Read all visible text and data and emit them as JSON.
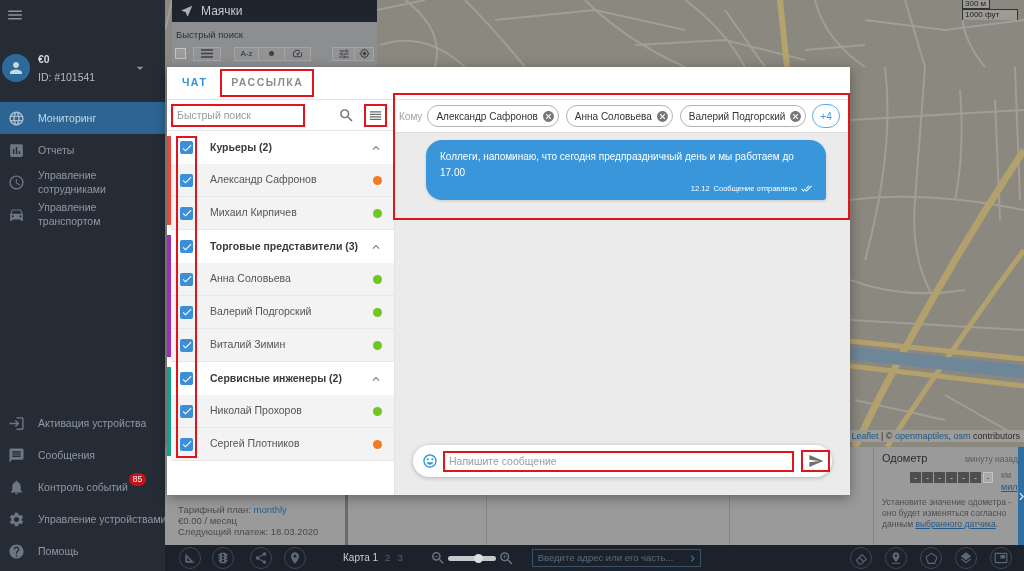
{
  "sidebar": {
    "account": {
      "balance": "€0",
      "id": "ID: #101541"
    },
    "nav_items": [
      {
        "label": "Мониторинг",
        "selected": true
      },
      {
        "label": "Отчеты",
        "selected": false
      },
      {
        "label": "Управление сотрудниками",
        "selected": false
      },
      {
        "label": "Управление транспортом",
        "selected": false
      }
    ],
    "footer_items": [
      {
        "label": "Активация устройства",
        "selected": false
      },
      {
        "label": "Сообщения",
        "selected": false
      },
      {
        "label": "Контроль событий",
        "selected": false,
        "badge": "85"
      },
      {
        "label": "Управление устройствами",
        "selected": false
      },
      {
        "label": "Помощь",
        "selected": false
      }
    ]
  },
  "beacons_panel": {
    "title": "Маячки",
    "search": {
      "placeholder": "Быстрый поиск"
    },
    "select_all": {
      "checked": false
    },
    "sort_label": "A-z"
  },
  "map": {
    "scale": [
      "300 м",
      "1000 фут"
    ],
    "attribution": [
      {
        "kind": "link",
        "text": "Leaflet"
      },
      {
        "kind": "text",
        "text": " | © "
      },
      {
        "kind": "link",
        "text": "openmaptiles"
      },
      {
        "kind": "text",
        "text": ", "
      },
      {
        "kind": "link",
        "text": "osm"
      },
      {
        "kind": "text",
        "text": " contributors"
      }
    ]
  },
  "bottom_panel": {
    "tariff": {
      "label": "Тарифный план:",
      "plan": "monthly"
    },
    "price": "€0.00 / месяц",
    "next_payment": "Следующий платеж: 18.03.2020",
    "odometer": {
      "title": "Одометр",
      "updated": "минуту назад",
      "digits": [
        "-",
        "-",
        "-",
        "-",
        "-",
        "-"
      ],
      "decimal": "-",
      "units": [
        {
          "label": "км",
          "selected": true
        },
        {
          "label": "мил",
          "selected": false
        }
      ],
      "hint": "Установите значение одометра - оно будет изменяться согласно данным ",
      "hint_link": "выбранного датчика",
      "hint_end": "."
    }
  },
  "toolbar": {
    "map_tabs": [
      {
        "label": "Карта 1",
        "selected": true
      },
      {
        "label": "2",
        "selected": false
      },
      {
        "label": "3",
        "selected": false
      }
    ],
    "zoom": {
      "level": 0.65
    },
    "address": {
      "placeholder": "Введите адрес или его часть..."
    }
  },
  "dialog": {
    "tabs": [
      {
        "label": "ЧАТ",
        "selected": true,
        "highlighted": false
      },
      {
        "label": "РАССЫЛКА",
        "selected": false,
        "highlighted": true
      }
    ],
    "search": {
      "placeholder": "Быстрый поиск",
      "highlighted": true
    },
    "list_menu": {
      "highlighted": true
    },
    "checkbox_column_highlighted": true,
    "groups": [
      {
        "name": "Курьеры (2)",
        "color": "#e8473d",
        "checked": true,
        "expanded": true,
        "members": [
          {
            "name": "Александр Сафронов",
            "checked": true,
            "color": "#f47c20"
          },
          {
            "name": "Михаил Кирпичев",
            "checked": true,
            "color": "#73c520"
          }
        ]
      },
      {
        "name": "Торговые представители (3)",
        "color": "#9c2fb0",
        "checked": true,
        "expanded": true,
        "members": [
          {
            "name": "Анна Соловьева",
            "checked": true,
            "color": "#73c520"
          },
          {
            "name": "Валерий Подгорский",
            "checked": true,
            "color": "#73c520"
          },
          {
            "name": "Виталий Зимин",
            "checked": true,
            "color": "#73c520"
          }
        ]
      },
      {
        "name": "Сервисные инженеры (2)",
        "color": "#17a08c",
        "checked": true,
        "expanded": true,
        "members": [
          {
            "name": "Николай Прохоров",
            "checked": true,
            "color": "#73c520"
          },
          {
            "name": "Сергей Плотников",
            "checked": true,
            "color": "#f47c20"
          }
        ]
      }
    ],
    "recipients": {
      "label": "Кому",
      "chips": [
        "Александр Сафронов",
        "Анна Соловьева",
        "Валерий Подгорский"
      ],
      "more": "+4"
    },
    "conversation_highlighted": true,
    "messages": [
      {
        "text": "Коллеги, напоминаю, что сегодня предпраздничный день и мы работаем до 17.00",
        "time": "12.12",
        "status": "Сообщение отправлено"
      }
    ],
    "composer": {
      "placeholder": "Напишите сообщение",
      "highlighted": true,
      "send_highlighted": true
    }
  }
}
